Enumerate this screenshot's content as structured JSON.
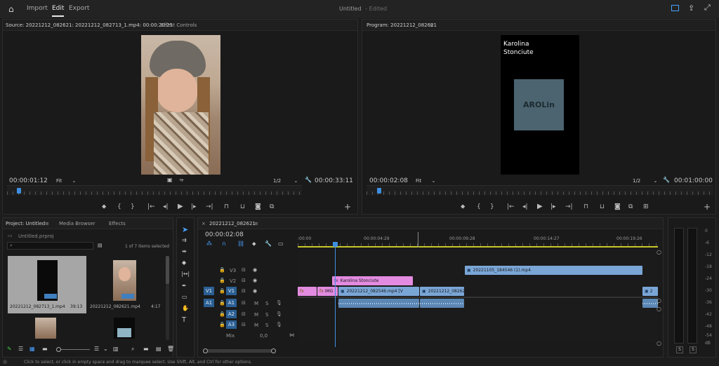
{
  "topbar": {
    "nav": [
      "Import",
      "Edit",
      "Export"
    ],
    "title": "Untitled",
    "status": "- Edited"
  },
  "source": {
    "tab": "Source: 20221212_082621: 20221212_082713_1.mp4: 00:00:20:25",
    "tab2": "Effect Controls",
    "timecode": "00:00:01:12",
    "fit": "Fit",
    "res": "1/2",
    "duration": "00:00:33:11"
  },
  "program": {
    "tab": "Program: 20221212_082621",
    "caption_line1": "Karolina",
    "caption_line2": "Stonciute",
    "logo_text": "AROLin",
    "timecode": "00:00:02:08",
    "fit": "Fit",
    "res": "1/2",
    "duration": "00:01:00:00"
  },
  "project": {
    "tabs": [
      "Project: Untitled",
      "Media Browser",
      "Effects"
    ],
    "file": "Untitled.prproj",
    "items_selected": "1 of 7 items selected",
    "items": [
      {
        "name": "20221212_082713_1.mp4",
        "dur": "39:13"
      },
      {
        "name": "20221212_082621.mp4",
        "dur": "4:17"
      }
    ]
  },
  "timeline": {
    "tab": "20221212_082621",
    "timecode": "00:00:02:08",
    "ruler": [
      ":00:00",
      "00:00:04:29",
      "00:00:09:28",
      "00:00:14:27",
      "00:00:19:26"
    ],
    "tracks": {
      "v3": "V3",
      "v2": "V2",
      "v1": "V1",
      "a1": "A1",
      "a2": "A2",
      "a3": "A3",
      "mix": "Mix",
      "mix_val": "0,0",
      "src_v1": "V1",
      "src_a1": "A1",
      "m": "M",
      "s": "S"
    },
    "clips": {
      "v3_clip": "20221105_184546 (1).mp4",
      "v2_title": "Karolina Stonciute",
      "v1_fx1": "fx",
      "v1_img": "IMG",
      "v1_clip1": "20221212_082546.mp4 [V",
      "v1_clip2": "20221212_082621",
      "v1_end": "2"
    }
  },
  "meters": {
    "scale": [
      "0",
      "-6",
      "-12",
      "-18",
      "-24",
      "-30",
      "-36",
      "-42",
      "-48",
      "-54",
      "dB"
    ],
    "solo_l": "S",
    "solo_r": "S"
  },
  "statusbar": {
    "text": "Click to select, or click in empty space and drag to marquee select. Use Shift, Alt, and Ctrl for other options."
  }
}
